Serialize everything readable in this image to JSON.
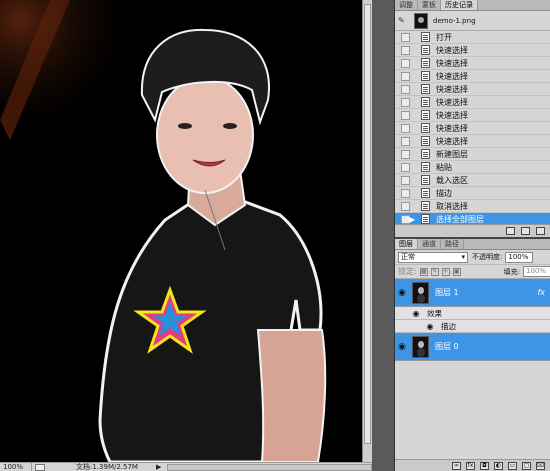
{
  "status": {
    "zoom": "100%",
    "doc_size": "文档:1.39M/2.57M",
    "arrow": "▶"
  },
  "history_panel": {
    "tabs": [
      "调整",
      "蒙板",
      "历史记录"
    ],
    "snapshot_name": "demo-1.png",
    "items": [
      "打开",
      "快速选择",
      "快速选择",
      "快速选择",
      "快速选择",
      "快速选择",
      "快速选择",
      "快速选择",
      "快速选择",
      "新建图层",
      "粘贴",
      "载入选区",
      "描边",
      "取消选择",
      "选择全部图层"
    ],
    "selected_index": 14
  },
  "layers_panel": {
    "tabs": [
      "图层",
      "通道",
      "路径"
    ],
    "blend_mode": "正常",
    "opacity_label": "不透明度:",
    "opacity_value": "100%",
    "lock_label": "锁定:",
    "fill_label": "填充:",
    "fill_value": "100%",
    "layers": [
      {
        "name": "图层 1",
        "fx": "fx",
        "selected": true
      },
      {
        "name": "图层 0",
        "fx": "",
        "selected": true
      }
    ],
    "effects_label": "效果",
    "effect_item": "描边"
  },
  "colors": {
    "selection": "#3d95e8",
    "panel_bg": "#d6d6d6",
    "canvas_bg": "#000000"
  }
}
